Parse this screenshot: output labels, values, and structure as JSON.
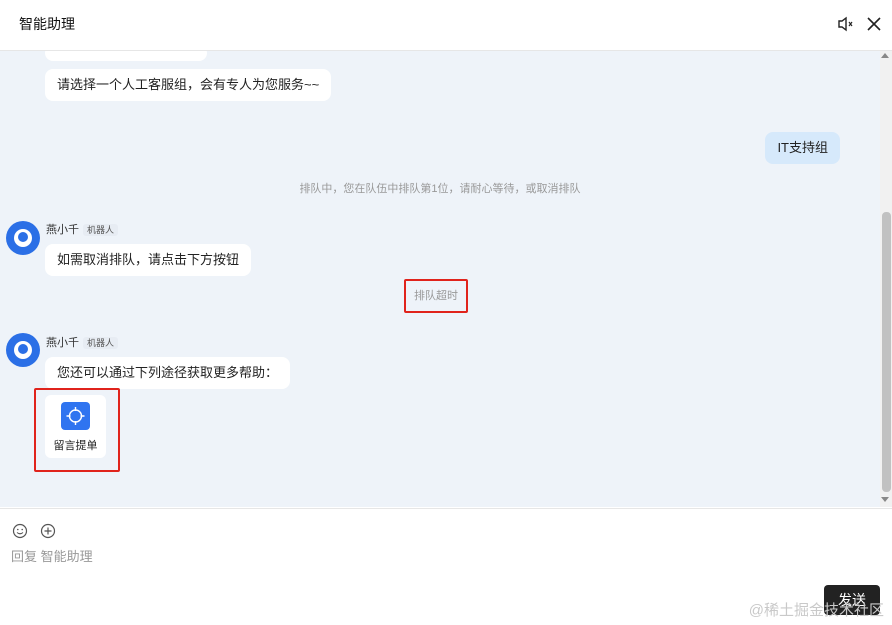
{
  "header": {
    "title": "智能助理",
    "mute_icon": "mute-speaker-icon",
    "close_icon": "close-icon"
  },
  "chat": {
    "bot_message_1": "请选择一个人工客服组，会有专人为您服务~~",
    "user_message": "IT支持组",
    "system_queue": "排队中，您在队伍中排队第1位，请耐心等待，或取消排队",
    "bot_name": "燕小千",
    "bot_badge": "机器人",
    "bot_message_2": "如需取消排队，请点击下方按钮",
    "system_timeout": "排队超时",
    "bot_message_3": "您还可以通过下列途径获取更多帮助：",
    "card_label": "留言提单"
  },
  "footer": {
    "reply_placeholder": "回复 智能助理",
    "send_label": "发送",
    "watermark": "@稀土掘金技术社区"
  },
  "colors": {
    "chat_bg": "#eef3f9",
    "accent_blue": "#2f74f0",
    "highlight_red": "#e0231c",
    "user_bubble": "#d6e9fb"
  }
}
